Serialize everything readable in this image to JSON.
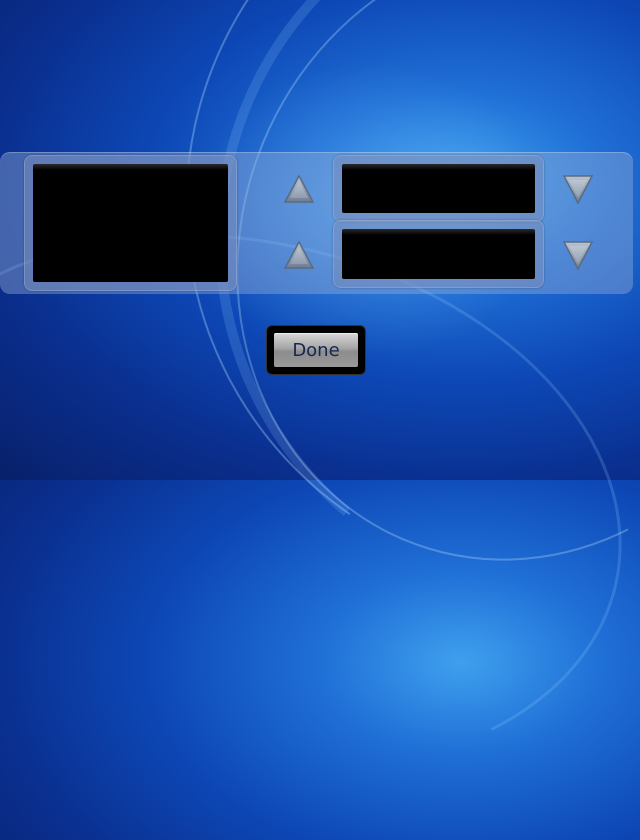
{
  "background": {
    "colors": {
      "center": "#3fa0ee",
      "mid": "#0d47b5",
      "edge": "#08206a"
    }
  },
  "panel": {
    "displays": {
      "main": {
        "value": ""
      },
      "top": {
        "value": ""
      },
      "bottom": {
        "value": ""
      }
    },
    "arrows": {
      "up_icon": "triangle-up-icon",
      "down_icon": "triangle-down-icon",
      "color": "#8a99ad"
    }
  },
  "done_button": {
    "label": "Done",
    "text_color": "#162650"
  }
}
